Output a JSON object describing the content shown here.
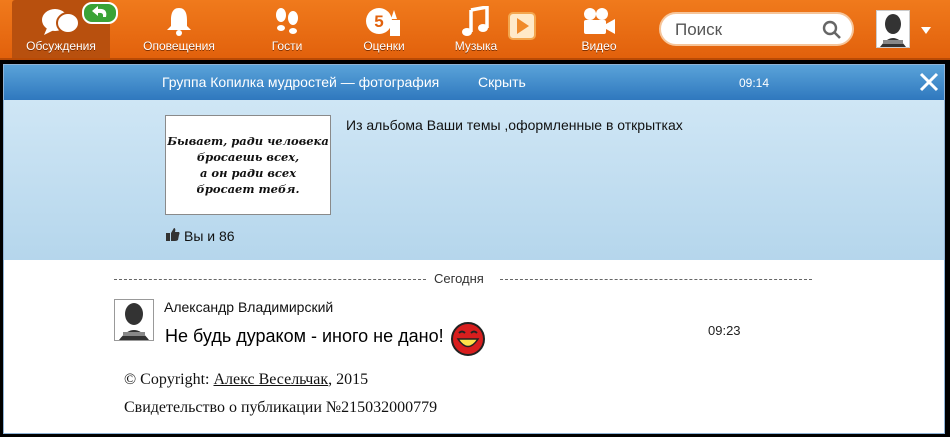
{
  "nav": {
    "items": [
      {
        "label": "Обсуждения",
        "icon": "chat-bubbles-icon"
      },
      {
        "label": "Оповещения",
        "icon": "bell-icon"
      },
      {
        "label": "Гости",
        "icon": "footprints-icon"
      },
      {
        "label": "Оценки",
        "icon": "rating-five-icon",
        "badge": "5"
      },
      {
        "label": "Музыка",
        "icon": "music-note-icon"
      },
      {
        "label": "Видео",
        "icon": "video-camera-icon"
      }
    ],
    "search_placeholder": "Поиск"
  },
  "notification": {
    "group_title": "Группа Копилка мудростей — фотография",
    "hide_label": "Скрыть",
    "time": "09:14",
    "photo_quote": [
      "Бывает, ради человека",
      "бросаешь всех,",
      "а он ради всех",
      "бросает тебя."
    ],
    "album_text": "Из альбома Ваши темы ,оформленные в открытках",
    "likes_text": "Вы и 86"
  },
  "comments": {
    "date_separator": "Сегодня",
    "author": "Александр Владимирский",
    "text": "Не будь дураком - иного не дано!",
    "time": "09:23"
  },
  "footer": {
    "copyright_prefix": "© Copyright: ",
    "copyright_author": "Алекс Весельчак",
    "copyright_year": ", 2015",
    "certificate": "Свидетельство о публикации №215032000779"
  },
  "colors": {
    "topbar": "#e96a14",
    "header_blue": "#3a85c8",
    "photo_bg": "#c4def0",
    "active_tab": "#b8500e"
  }
}
